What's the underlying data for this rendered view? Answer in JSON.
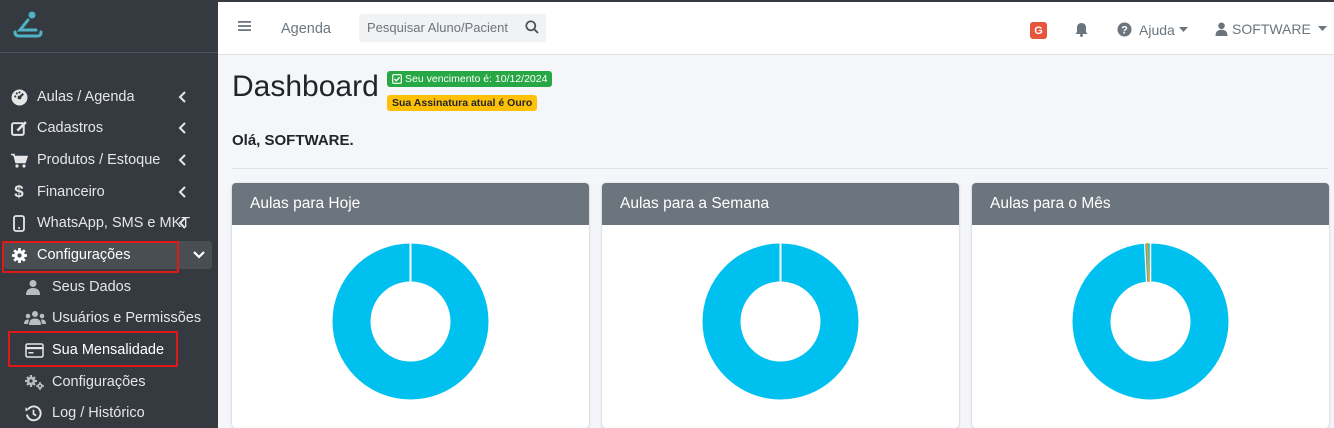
{
  "sidebar": {
    "logo": "stick-figure-logo",
    "items": [
      {
        "label": "Aulas / Agenda",
        "icon": "gauge-icon"
      },
      {
        "label": "Cadastros",
        "icon": "edit-icon"
      },
      {
        "label": "Produtos / Estoque",
        "icon": "cart-icon"
      },
      {
        "label": "Financeiro",
        "icon": "dollar-icon"
      },
      {
        "label": "WhatsApp, SMS e MKT",
        "icon": "mobile-icon"
      },
      {
        "label": "Configurações",
        "icon": "gear-icon"
      }
    ],
    "subitems": [
      {
        "label": "Seus Dados",
        "icon": "user-icon"
      },
      {
        "label": "Usuários e Permissões",
        "icon": "users-icon"
      },
      {
        "label": "Sua Mensalidade",
        "icon": "credit-card-icon"
      },
      {
        "label": "Configurações",
        "icon": "cogs-icon"
      },
      {
        "label": "Log / Histórico",
        "icon": "history-icon"
      }
    ]
  },
  "topbar": {
    "menu_icon": "hamburger-icon",
    "agenda_label": "Agenda",
    "search_placeholder": "Pesquisar Aluno/Pacient",
    "g_badge": "G",
    "help_label": "Ajuda",
    "user_label": "SOFTWARE"
  },
  "main": {
    "title": "Dashboard",
    "badge_due": "Seu vencimento é: 10/12/2024",
    "badge_plan": "Sua Assinatura atual é Ouro",
    "greeting": "Olá, SOFTWARE.",
    "cards": [
      {
        "title": "Aulas para Hoje"
      },
      {
        "title": "Aulas para a Semana"
      },
      {
        "title": "Aulas para o Mês"
      }
    ]
  },
  "colors": {
    "sidebar_bg": "#343a40",
    "accent_cyan": "#00c0ef",
    "card_header": "#6c757d",
    "badge_green": "#28a745",
    "badge_yellow": "#ffc107",
    "highlight_red": "#e01818",
    "g_red": "#e8553e"
  }
}
